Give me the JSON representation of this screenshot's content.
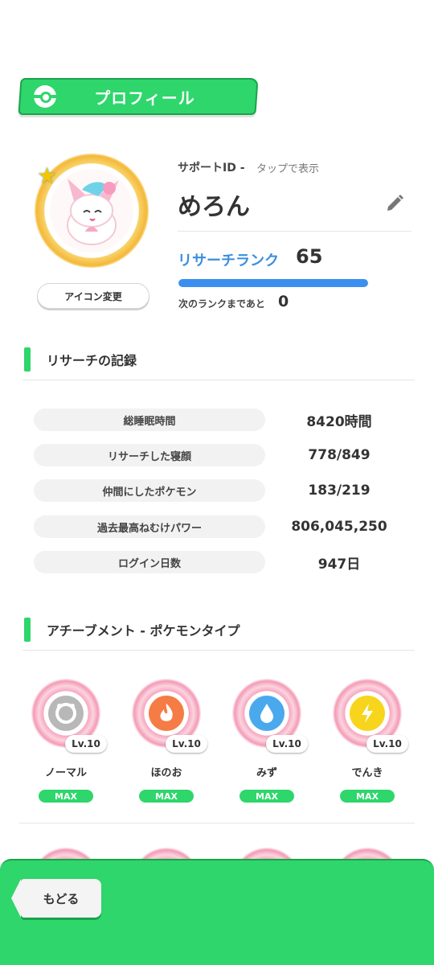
{
  "header": {
    "title": "プロフィール"
  },
  "profile": {
    "support_id_label": "サポートID -",
    "support_id_hint": "タップで表示",
    "name": "めろん",
    "icon_change_label": "アイコン変更",
    "research_rank_label": "リサーチランク",
    "research_rank": "65",
    "rank_progress_percent": 100,
    "next_rank_label": "次のランクまであと",
    "next_rank_value": "0"
  },
  "records": {
    "title": "リサーチの記録",
    "rows": [
      {
        "label": "総睡眠時間",
        "value": "8420時間"
      },
      {
        "label": "リサーチした寝顔",
        "value": "778/849"
      },
      {
        "label": "仲間にしたポケモン",
        "value": "183/219"
      },
      {
        "label": "過去最高ねむけパワー",
        "value": "806,045,250"
      },
      {
        "label": "ログイン日数",
        "value": "947日"
      }
    ]
  },
  "achievements": {
    "title": "アチーブメント - ポケモンタイプ",
    "badges": [
      {
        "name": "ノーマル",
        "level": "Lv.10",
        "status": "MAX",
        "color": "#b8b8b8",
        "icon": "normal-type-icon"
      },
      {
        "name": "ほのお",
        "level": "Lv.10",
        "status": "MAX",
        "color": "#f57c45",
        "icon": "fire-type-icon"
      },
      {
        "name": "みず",
        "level": "Lv.10",
        "status": "MAX",
        "color": "#4aa8ec",
        "icon": "water-type-icon"
      },
      {
        "name": "でんき",
        "level": "Lv.10",
        "status": "MAX",
        "color": "#f7d51c",
        "icon": "electric-type-icon"
      }
    ]
  },
  "footer": {
    "back_label": "もどる"
  },
  "colors": {
    "accent_green": "#2ed66b",
    "rank_blue": "#3b8ff0"
  }
}
